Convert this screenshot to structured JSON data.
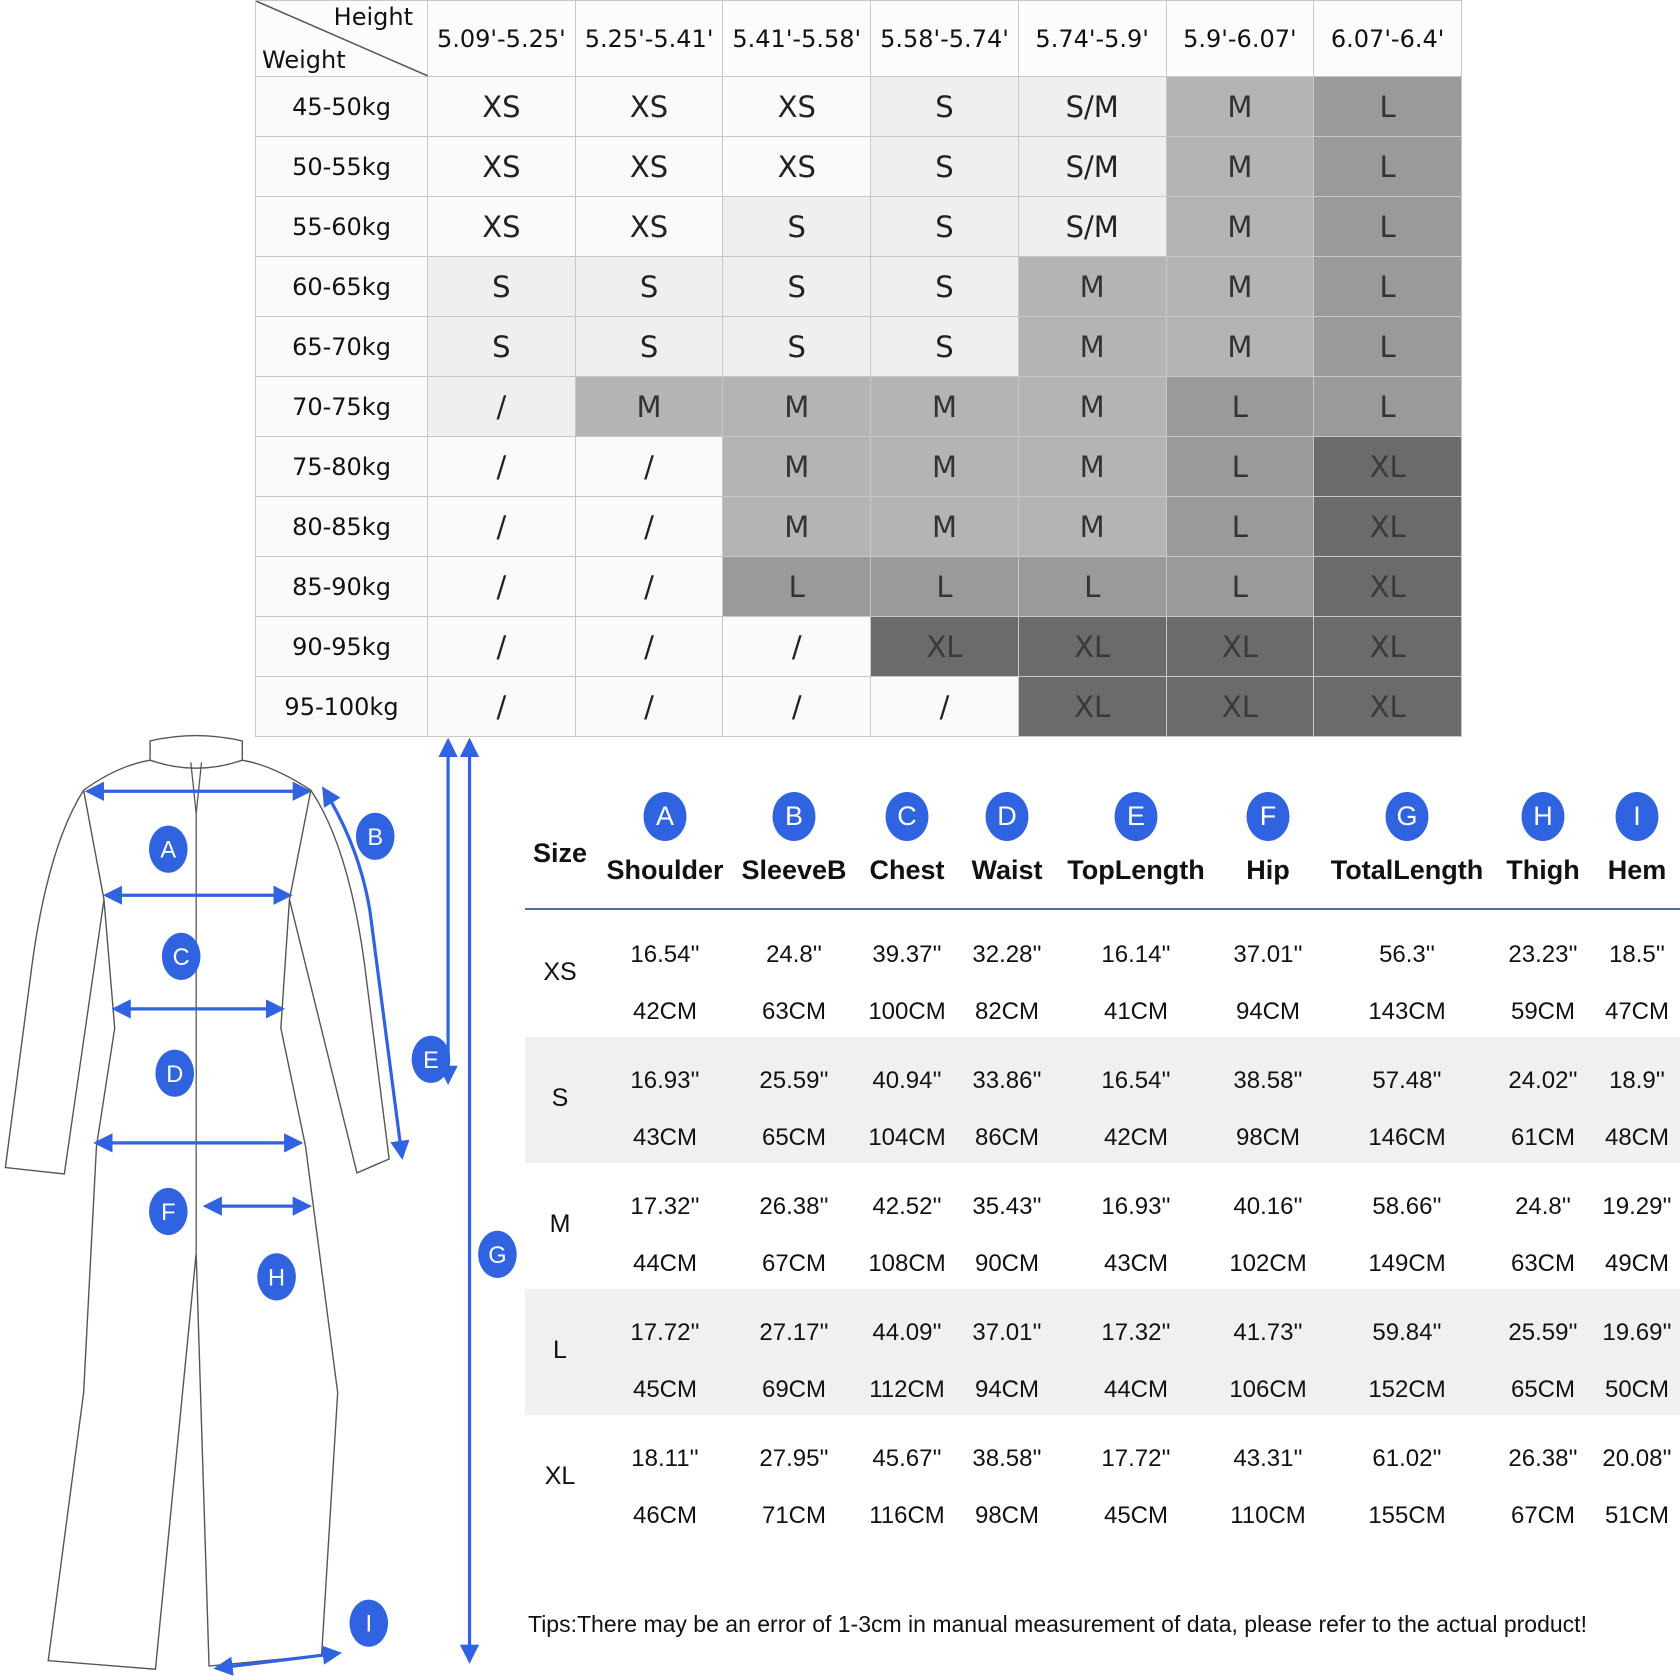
{
  "palette": {
    "white": "#fafafc",
    "light": "#efefef",
    "medium": "#b4b4b4",
    "dark": "#9a9a9a",
    "darkest": "#6b6b6b",
    "accent": "#2f63e0"
  },
  "size_grid": {
    "corner_top": "Height",
    "corner_bottom": "Weight",
    "heights": [
      "5.09'-5.25'",
      "5.25'-5.41'",
      "5.41'-5.58'",
      "5.58'-5.74'",
      "5.74'-5.9'",
      "5.9'-6.07'",
      "6.07'-6.4'"
    ],
    "rows": [
      {
        "weight": "45-50kg",
        "cells": [
          [
            "XS",
            "white"
          ],
          [
            "XS",
            "white"
          ],
          [
            "XS",
            "white"
          ],
          [
            "S",
            "light"
          ],
          [
            "S/M",
            "light"
          ],
          [
            "M",
            "medium"
          ],
          [
            "L",
            "dark"
          ]
        ]
      },
      {
        "weight": "50-55kg",
        "cells": [
          [
            "XS",
            "white"
          ],
          [
            "XS",
            "white"
          ],
          [
            "XS",
            "white"
          ],
          [
            "S",
            "light"
          ],
          [
            "S/M",
            "light"
          ],
          [
            "M",
            "medium"
          ],
          [
            "L",
            "dark"
          ]
        ]
      },
      {
        "weight": "55-60kg",
        "cells": [
          [
            "XS",
            "white"
          ],
          [
            "XS",
            "white"
          ],
          [
            "S",
            "light"
          ],
          [
            "S",
            "light"
          ],
          [
            "S/M",
            "light"
          ],
          [
            "M",
            "medium"
          ],
          [
            "L",
            "dark"
          ]
        ]
      },
      {
        "weight": "60-65kg",
        "cells": [
          [
            "S",
            "light"
          ],
          [
            "S",
            "light"
          ],
          [
            "S",
            "light"
          ],
          [
            "S",
            "light"
          ],
          [
            "M",
            "medium"
          ],
          [
            "M",
            "medium"
          ],
          [
            "L",
            "dark"
          ]
        ]
      },
      {
        "weight": "65-70kg",
        "cells": [
          [
            "S",
            "light"
          ],
          [
            "S",
            "light"
          ],
          [
            "S",
            "light"
          ],
          [
            "S",
            "light"
          ],
          [
            "M",
            "medium"
          ],
          [
            "M",
            "medium"
          ],
          [
            "L",
            "dark"
          ]
        ]
      },
      {
        "weight": "70-75kg",
        "cells": [
          [
            "/",
            "light"
          ],
          [
            "M",
            "medium"
          ],
          [
            "M",
            "medium"
          ],
          [
            "M",
            "medium"
          ],
          [
            "M",
            "medium"
          ],
          [
            "L",
            "dark"
          ],
          [
            "L",
            "dark"
          ]
        ]
      },
      {
        "weight": "75-80kg",
        "cells": [
          [
            "/",
            "white"
          ],
          [
            "/",
            "white"
          ],
          [
            "M",
            "medium"
          ],
          [
            "M",
            "medium"
          ],
          [
            "M",
            "medium"
          ],
          [
            "L",
            "dark"
          ],
          [
            "XL",
            "darkest"
          ]
        ]
      },
      {
        "weight": "80-85kg",
        "cells": [
          [
            "/",
            "white"
          ],
          [
            "/",
            "white"
          ],
          [
            "M",
            "medium"
          ],
          [
            "M",
            "medium"
          ],
          [
            "M",
            "medium"
          ],
          [
            "L",
            "dark"
          ],
          [
            "XL",
            "darkest"
          ]
        ]
      },
      {
        "weight": "85-90kg",
        "cells": [
          [
            "/",
            "white"
          ],
          [
            "/",
            "white"
          ],
          [
            "L",
            "dark"
          ],
          [
            "L",
            "dark"
          ],
          [
            "L",
            "dark"
          ],
          [
            "L",
            "dark"
          ],
          [
            "XL",
            "darkest"
          ]
        ]
      },
      {
        "weight": "90-95kg",
        "cells": [
          [
            "/",
            "white"
          ],
          [
            "/",
            "white"
          ],
          [
            "/",
            "white"
          ],
          [
            "XL",
            "darkest"
          ],
          [
            "XL",
            "darkest"
          ],
          [
            "XL",
            "darkest"
          ],
          [
            "XL",
            "darkest"
          ]
        ]
      },
      {
        "weight": "95-100kg",
        "cells": [
          [
            "/",
            "white"
          ],
          [
            "/",
            "white"
          ],
          [
            "/",
            "white"
          ],
          [
            "/",
            "white"
          ],
          [
            "XL",
            "darkest"
          ],
          [
            "XL",
            "darkest"
          ],
          [
            "XL",
            "darkest"
          ]
        ]
      }
    ]
  },
  "measurements": {
    "size_header": "Size",
    "columns": [
      {
        "letter": "A",
        "label": "Shoulder"
      },
      {
        "letter": "B",
        "label": "SleeveB"
      },
      {
        "letter": "C",
        "label": "Chest"
      },
      {
        "letter": "D",
        "label": "Waist"
      },
      {
        "letter": "E",
        "label": "TopLength"
      },
      {
        "letter": "F",
        "label": "Hip"
      },
      {
        "letter": "G",
        "label": "TotalLength"
      },
      {
        "letter": "H",
        "label": "Thigh"
      },
      {
        "letter": "I",
        "label": "Hem"
      }
    ],
    "rows": [
      {
        "size": "XS",
        "inch": [
          "16.54''",
          "24.8''",
          "39.37''",
          "32.28''",
          "16.14''",
          "37.01''",
          "56.3''",
          "23.23''",
          "18.5''"
        ],
        "cm": [
          "42CM",
          "63CM",
          "100CM",
          "82CM",
          "41CM",
          "94CM",
          "143CM",
          "59CM",
          "47CM"
        ]
      },
      {
        "size": "S",
        "inch": [
          "16.93''",
          "25.59''",
          "40.94''",
          "33.86''",
          "16.54''",
          "38.58''",
          "57.48''",
          "24.02''",
          "18.9''"
        ],
        "cm": [
          "43CM",
          "65CM",
          "104CM",
          "86CM",
          "42CM",
          "98CM",
          "146CM",
          "61CM",
          "48CM"
        ]
      },
      {
        "size": "M",
        "inch": [
          "17.32''",
          "26.38''",
          "42.52''",
          "35.43''",
          "16.93''",
          "40.16''",
          "58.66''",
          "24.8''",
          "19.29''"
        ],
        "cm": [
          "44CM",
          "67CM",
          "108CM",
          "90CM",
          "43CM",
          "102CM",
          "149CM",
          "63CM",
          "49CM"
        ]
      },
      {
        "size": "L",
        "inch": [
          "17.72''",
          "27.17''",
          "44.09''",
          "37.01''",
          "17.32''",
          "41.73''",
          "59.84''",
          "25.59''",
          "19.69''"
        ],
        "cm": [
          "45CM",
          "69CM",
          "112CM",
          "94CM",
          "44CM",
          "106CM",
          "152CM",
          "65CM",
          "50CM"
        ]
      },
      {
        "size": "XL",
        "inch": [
          "18.11''",
          "27.95''",
          "45.67''",
          "38.58''",
          "17.72''",
          "43.31''",
          "61.02''",
          "26.38''",
          "20.08''"
        ],
        "cm": [
          "46CM",
          "71CM",
          "116CM",
          "98CM",
          "45CM",
          "110CM",
          "155CM",
          "67CM",
          "51CM"
        ]
      }
    ]
  },
  "figure": {
    "labels": [
      "A",
      "B",
      "C",
      "D",
      "E",
      "F",
      "G",
      "H",
      "I"
    ]
  },
  "tips": "Tips:There may be an error of 1-3cm in manual measurement of data, please refer to the actual product!"
}
